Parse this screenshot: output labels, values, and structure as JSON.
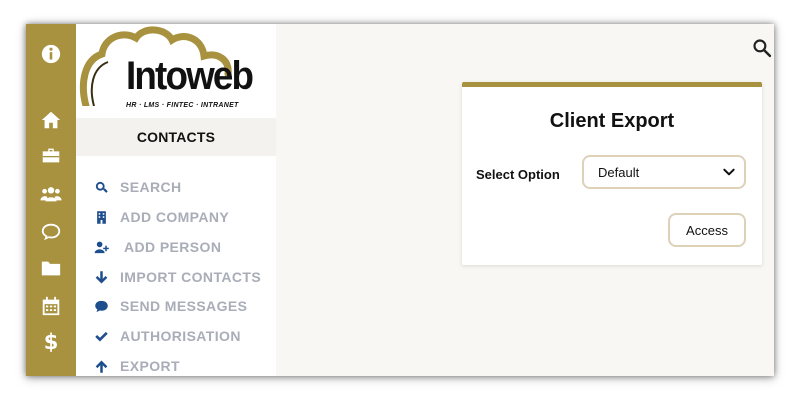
{
  "brand": {
    "name_part1": "Into",
    "name_part2": "web",
    "tagline": "HR · LMS · FINTEC · INTRANET",
    "accent_color": "#a8923f"
  },
  "rail": {
    "items": [
      {
        "name": "info-icon"
      },
      {
        "name": "home-icon"
      },
      {
        "name": "briefcase-icon"
      },
      {
        "name": "users-icon"
      },
      {
        "name": "chat-icon"
      },
      {
        "name": "folder-icon"
      },
      {
        "name": "calendar-icon"
      },
      {
        "name": "dollar-icon",
        "text": "$"
      }
    ]
  },
  "nav": {
    "section_title": "CONTACTS",
    "items": [
      {
        "label": "SEARCH",
        "icon": "search-icon"
      },
      {
        "label": "ADD COMPANY",
        "icon": "building-icon"
      },
      {
        "label": "ADD PERSON",
        "icon": "user-plus-icon"
      },
      {
        "label": "IMPORT CONTACTS",
        "icon": "arrow-down-icon"
      },
      {
        "label": "SEND MESSAGES",
        "icon": "speech-bubble-icon"
      },
      {
        "label": "AUTHORISATION",
        "icon": "checkmark-icon"
      },
      {
        "label": "EXPORT",
        "icon": "arrow-up-icon"
      }
    ],
    "icon_color": "#1f4e8f",
    "label_color": "#a9adb8"
  },
  "card": {
    "title": "Client Export",
    "select_label": "Select Option",
    "select_value": "Default",
    "access_label": "Access"
  }
}
